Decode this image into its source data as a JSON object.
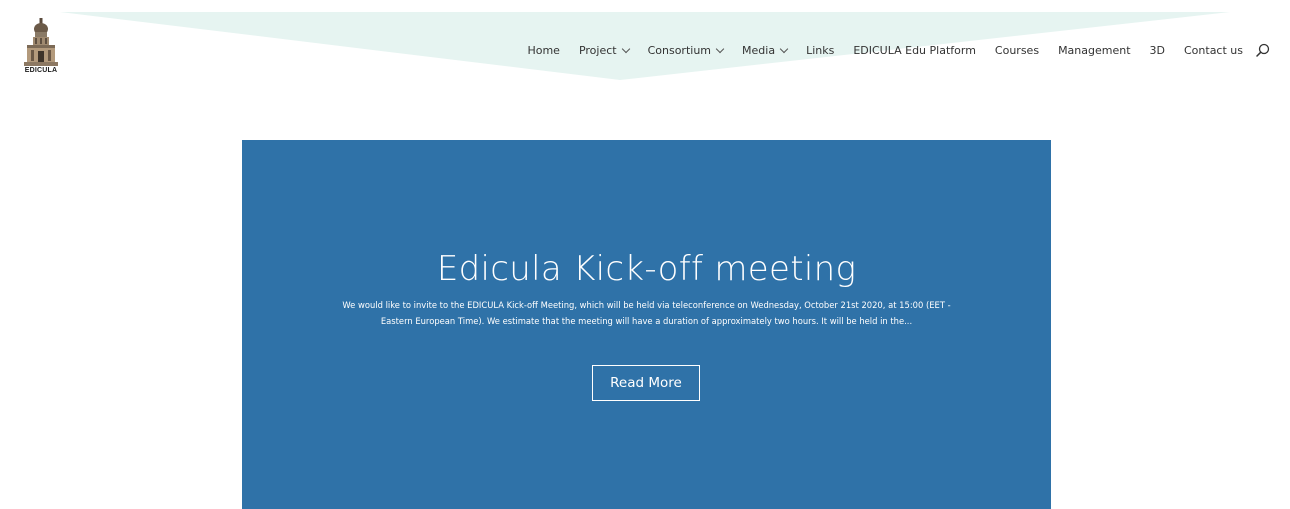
{
  "site": {
    "logo_text": "EDICULA"
  },
  "nav": {
    "items": [
      {
        "label": "Home",
        "has_dropdown": false
      },
      {
        "label": "Project",
        "has_dropdown": true
      },
      {
        "label": "Consortium",
        "has_dropdown": true
      },
      {
        "label": "Media",
        "has_dropdown": true
      },
      {
        "label": "Links",
        "has_dropdown": false
      },
      {
        "label": "EDICULA Edu Platform",
        "has_dropdown": false
      },
      {
        "label": "Courses",
        "has_dropdown": false
      },
      {
        "label": "Management",
        "has_dropdown": false
      },
      {
        "label": "3D",
        "has_dropdown": false
      },
      {
        "label": "Contact us",
        "has_dropdown": false
      }
    ],
    "search_icon": "search-icon"
  },
  "hero": {
    "title": "Edicula Kick-off meeting",
    "excerpt": "We would like to invite to the EDICULA Kick-off Meeting, which will be held via teleconference on Wednesday, October 21st 2020, at 15:00 (EET - Eastern European Time). We estimate that the meeting will have a duration of approximately two hours. It will be held in the...",
    "button_label": "Read More"
  },
  "colors": {
    "hero_background": "#2f72a8",
    "header_wedge": "#e6f4f1",
    "text_dark": "#333333"
  }
}
